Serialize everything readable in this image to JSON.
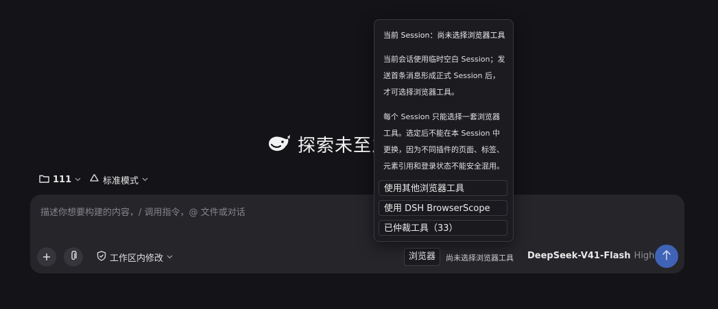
{
  "hero": {
    "title": "探索未至之境"
  },
  "toolbar": {
    "folder_label": "111",
    "mode_label": "标准模式"
  },
  "composer": {
    "placeholder": "描述你想要构建的内容，/ 调用指令，@ 文件或对话",
    "scope_label": "工作区内修改",
    "browser_button_label": "浏览器",
    "browser_status": "尚未选择浏览器工具",
    "model_name": "DeepSeek-V41-Flash",
    "model_level": "High"
  },
  "popover": {
    "title": "当前 Session：尚未选择浏览器工具",
    "para1": "当前会话使用临时空白 Session；发送首条消息形成正式 Session 后，才可选择浏览器工具。",
    "para2": "每个 Session 只能选择一套浏览器工具。选定后不能在本 Session 中更换，因为不同插件的页面、标签、元素引用和登录状态不能安全混用。",
    "options": [
      "使用其他浏览器工具",
      "使用 DSH BrowserScope",
      "已仲裁工具（33）"
    ]
  },
  "icons": {
    "logo": "whale-logo-icon",
    "folder": "folder-icon",
    "mode": "recycle-icon",
    "plus": "plus-icon",
    "attach": "paperclip-icon",
    "scope": "shield-icon",
    "chevron": "chevron-down-icon",
    "send": "arrow-up-icon"
  },
  "colors": {
    "background": "#141317",
    "composer": "#26252a",
    "send": "#3f63b6"
  }
}
